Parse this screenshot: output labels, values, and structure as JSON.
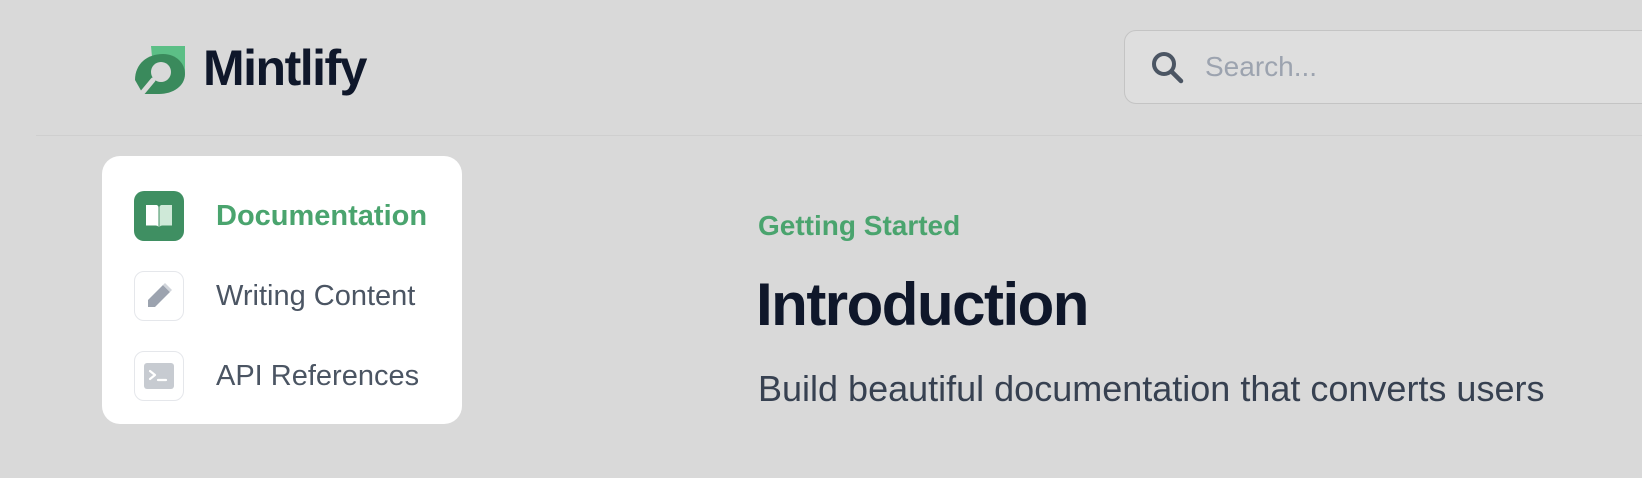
{
  "header": {
    "brand": "Mintlify",
    "search": {
      "placeholder": "Search...",
      "value": ""
    }
  },
  "nav": {
    "items": [
      {
        "label": "Documentation",
        "icon": "book-open-icon",
        "active": true
      },
      {
        "label": "Writing Content",
        "icon": "pencil-icon",
        "active": false
      },
      {
        "label": "API References",
        "icon": "terminal-icon",
        "active": false
      }
    ]
  },
  "main": {
    "eyebrow": "Getting Started",
    "title": "Introduction",
    "subtitle": "Build beautiful documentation that converts users"
  },
  "colors": {
    "accent": "#4aa46e",
    "accent_dark": "#3f8f62",
    "background": "#d9d9d9",
    "text_primary": "#0f172a"
  }
}
